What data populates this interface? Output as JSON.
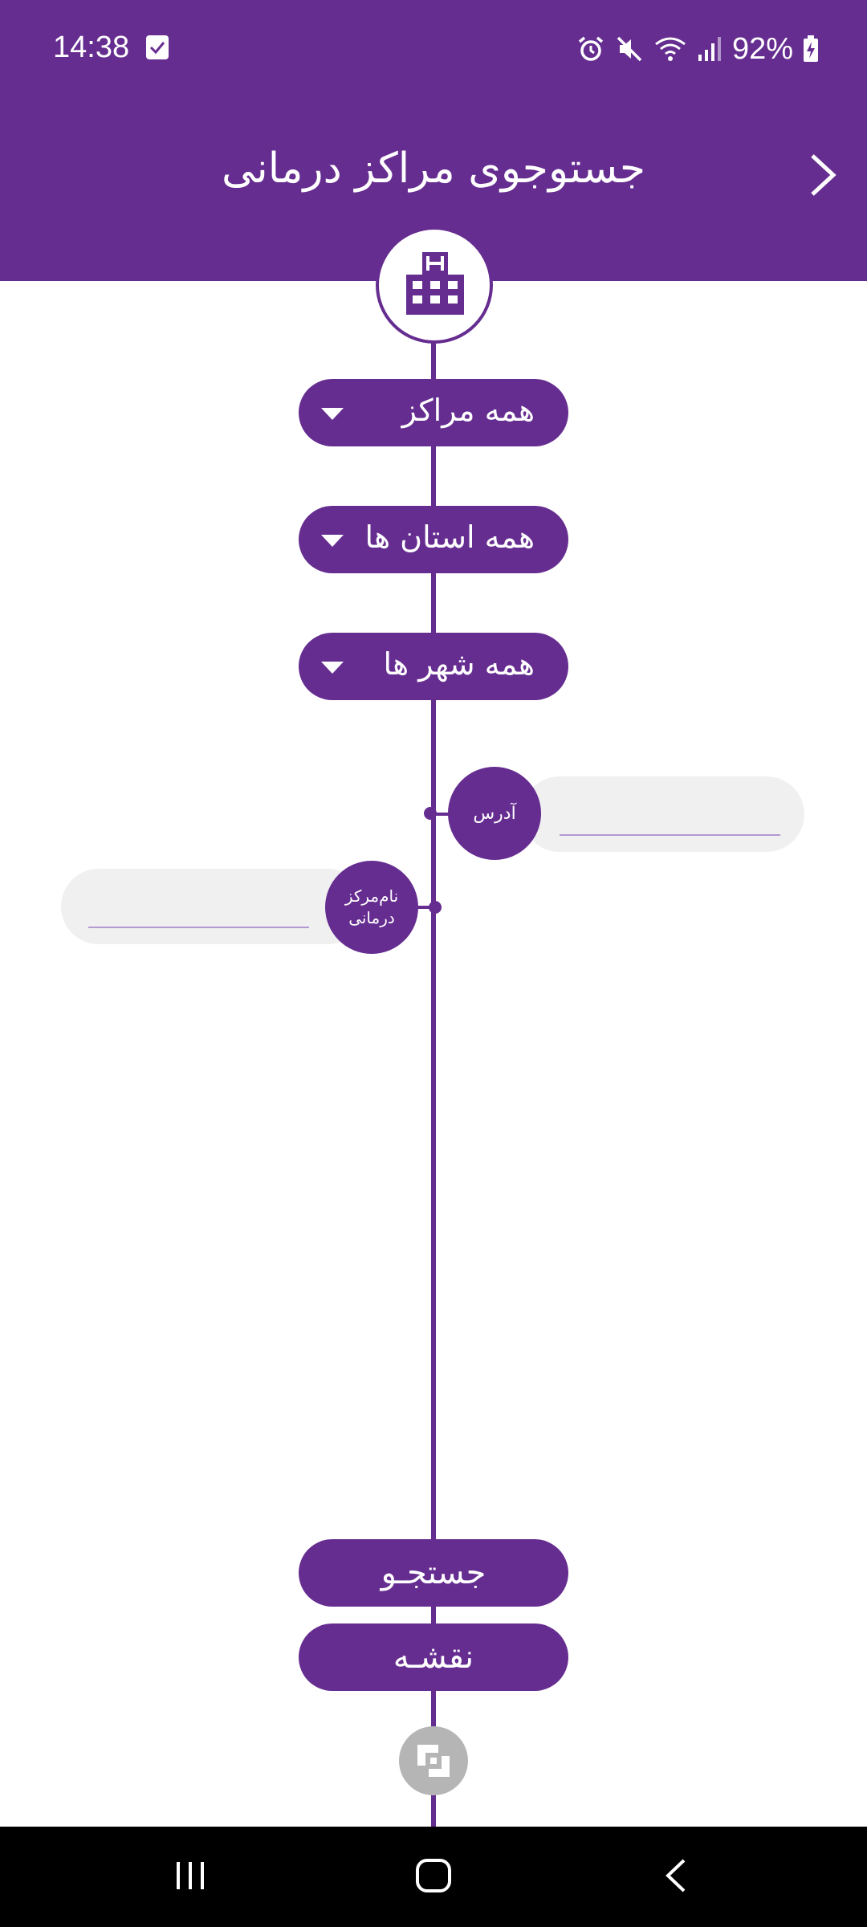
{
  "status_bar": {
    "time": "14:38",
    "battery": "92%"
  },
  "header": {
    "title": "جستوجوی مراکز درمانی"
  },
  "filters": {
    "center_type": "همه مراکز",
    "province": "همه استان ها",
    "city": "همه شهر ها"
  },
  "fields": {
    "address_label": "آدرس",
    "address_value": "",
    "center_name_label": "نام‌مرکز درمانی",
    "center_name_value": ""
  },
  "actions": {
    "search_label": "جستجـو",
    "map_label": "نقشـه"
  },
  "colors": {
    "primary": "#662d91",
    "field_bg": "#f0f0f0",
    "logo_gray": "#b5b5b5"
  },
  "icons": [
    "hospital-icon",
    "dropdown-caret-icon",
    "back-chevron-icon",
    "bank-logo-icon"
  ]
}
